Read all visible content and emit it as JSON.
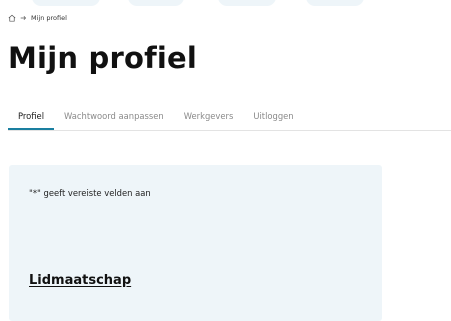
{
  "breadcrumb": {
    "home_icon": "home-icon",
    "separator_icon": "arrow-right-icon",
    "current": "Mijn profiel"
  },
  "page": {
    "title": "Mijn profiel"
  },
  "tabs": [
    {
      "label": "Profiel",
      "active": true
    },
    {
      "label": "Wachtwoord aanpassen",
      "active": false
    },
    {
      "label": "Werkgevers",
      "active": false
    },
    {
      "label": "Uitloggen",
      "active": false
    }
  ],
  "form": {
    "required_note": "\"*\" geeft vereiste velden aan",
    "section_title": "Lidmaatschap"
  },
  "colors": {
    "accent": "#1a7fa0",
    "panel_bg": "#eef5f9",
    "muted_text": "#8a8a8a"
  }
}
